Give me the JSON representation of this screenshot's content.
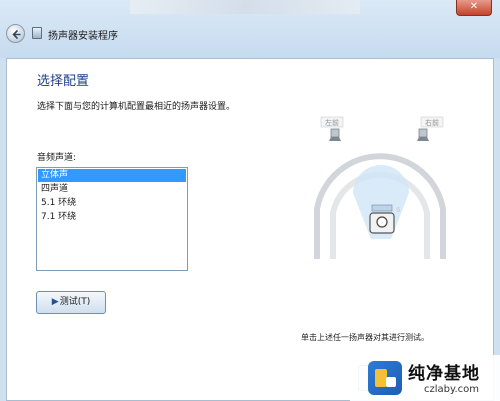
{
  "window": {
    "title": "扬声器安装程序",
    "close_label": "✕"
  },
  "page": {
    "heading": "选择配置",
    "description": "选择下面与您的计算机配置最相近的扬声器设置。",
    "channel_label": "音频声道:",
    "channels": [
      "立体声",
      "四声道",
      "5.1 环绕",
      "7.1 环绕"
    ],
    "selected_channel": "立体声",
    "test_button_label": "测试(T)",
    "hint": "单击上述任一扬声器对其进行测试。"
  },
  "diagram": {
    "left_label": "左前",
    "right_label": "右前"
  },
  "watermark": {
    "title": "纯净基地",
    "url": "czlaby.com"
  },
  "icons": {
    "back": "back-arrow-icon",
    "app": "speaker-setup-icon",
    "test_play": "play-icon",
    "speaker": "speaker-icon",
    "listener": "listener-icon"
  },
  "colors": {
    "heading": "#1e3f8a",
    "selection": "#3399ff",
    "frame": "#cfe0f1"
  }
}
